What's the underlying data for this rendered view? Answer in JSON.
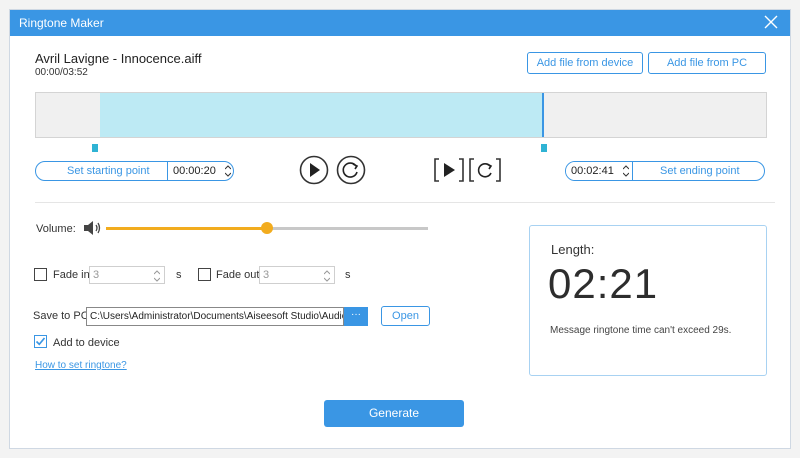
{
  "window": {
    "title": "Ringtone Maker"
  },
  "file": {
    "name": "Avril Lavigne - Innocence.aiff",
    "time": "00:00/03:52"
  },
  "buttons": {
    "add_from_device": "Add file from device",
    "add_from_pc": "Add file from PC",
    "open": "Open",
    "browse": "···",
    "generate": "Generate"
  },
  "range": {
    "start_label": "Set starting point",
    "start_value": "00:00:20",
    "end_label": "Set ending point",
    "end_value": "00:02:41"
  },
  "volume": {
    "label": "Volume:",
    "level_percent": 50
  },
  "fade": {
    "in_label": "Fade in",
    "in_value": "3",
    "out_label": "Fade out",
    "out_value": "3",
    "unit": "s"
  },
  "save": {
    "label": "Save to PC:",
    "path": "C:\\Users\\Administrator\\Documents\\Aiseesoft Studio\\Audio",
    "add_to_device_label": "Add to device",
    "add_to_device_checked": true
  },
  "help_link": "How to set ringtone?",
  "length": {
    "label": "Length:",
    "value": "02:21",
    "note": "Message ringtone time can't exceed 29s."
  },
  "colors": {
    "accent": "#3a96e4",
    "selection": "#bdeaf4",
    "slider": "#f2ac1e"
  }
}
